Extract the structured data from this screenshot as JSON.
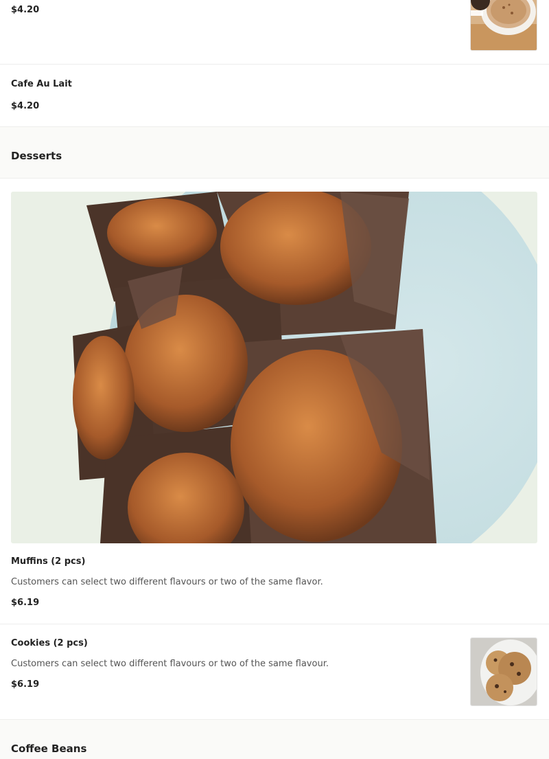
{
  "menu": {
    "items_top": [
      {
        "name": "",
        "price": "$4.20"
      },
      {
        "name": "Cafe Au Lait",
        "price": "$4.20"
      }
    ],
    "sections": [
      {
        "title": "Desserts",
        "items": [
          {
            "name": "Muffins (2 pcs)",
            "description": "Customers can select two different flavours or two of the same flavor.",
            "price": "$6.19"
          },
          {
            "name": "Cookies (2 pcs)",
            "description": "Customers can select two different flavours or two of the same flavour.",
            "price": "$6.19"
          }
        ]
      },
      {
        "title": "Coffee Beans",
        "items": []
      }
    ]
  },
  "images": {
    "latte": "latte-photo",
    "muffins": "muffins-photo",
    "cookies": "cookies-photo"
  }
}
